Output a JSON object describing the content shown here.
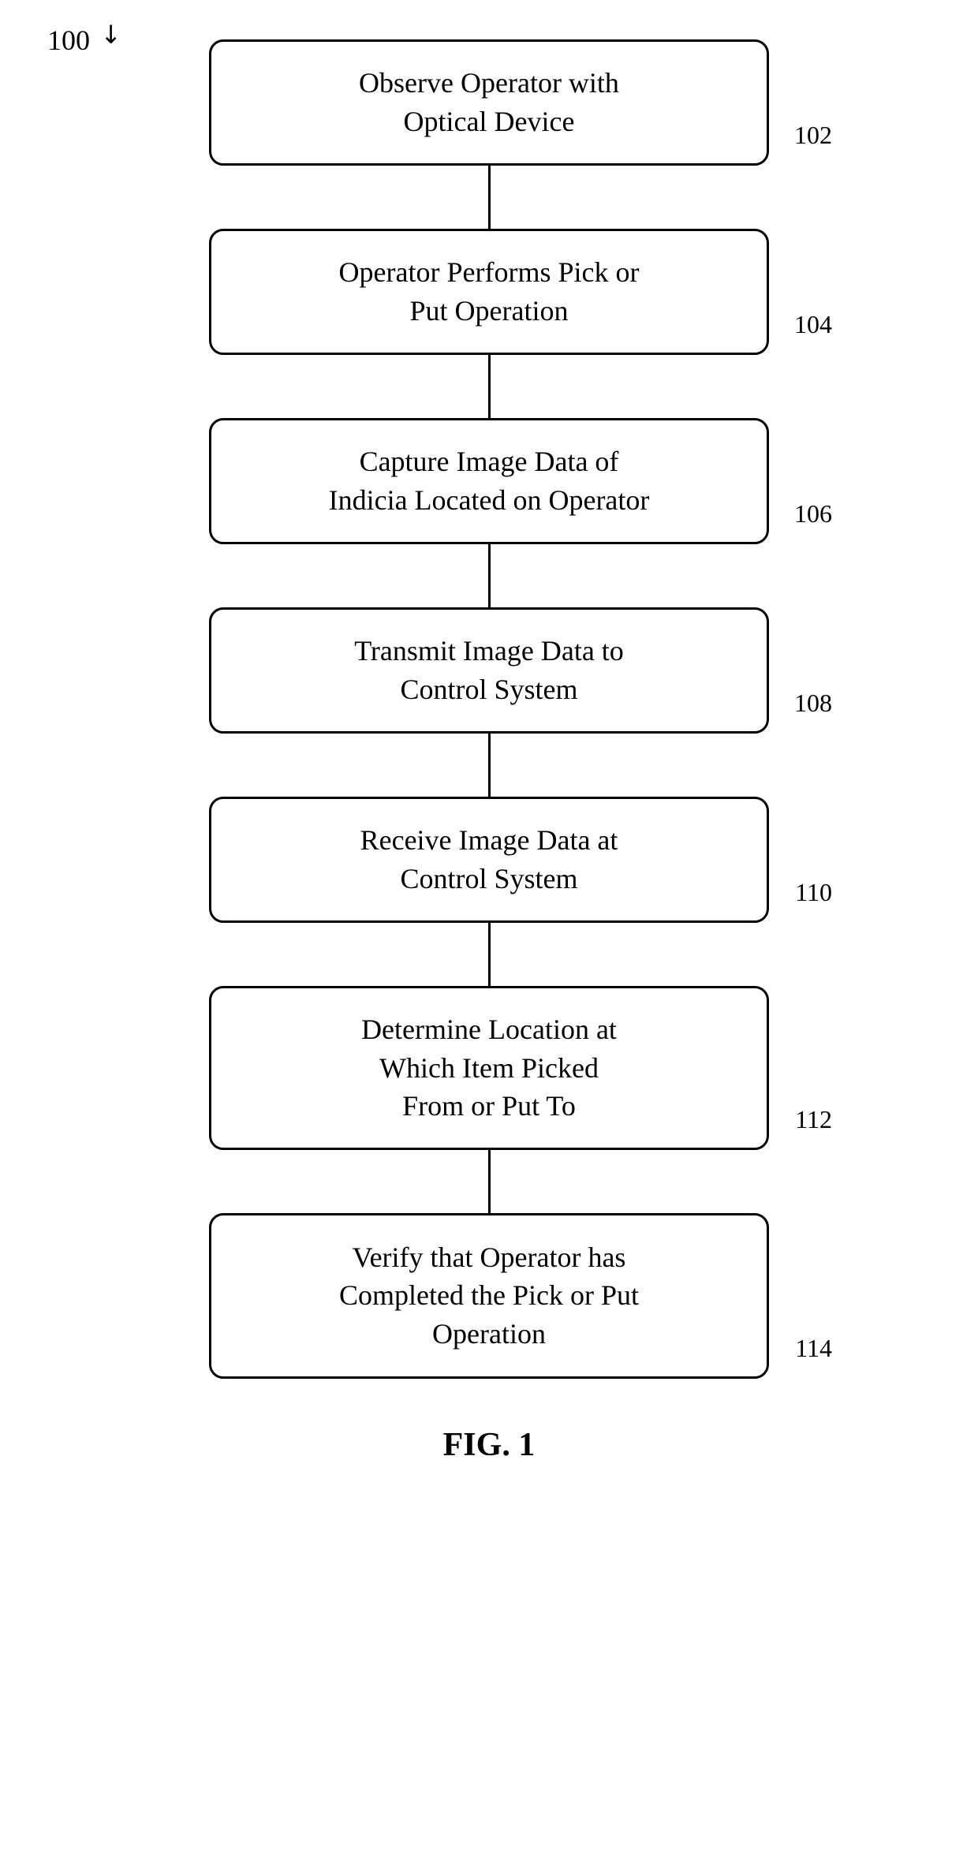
{
  "diagram": {
    "figure_label": "FIG. 1",
    "diagram_number": "100",
    "steps": [
      {
        "id": "step-102",
        "label": "102",
        "text": "Observe Operator with\nOptical Device"
      },
      {
        "id": "step-104",
        "label": "104",
        "text": "Operator Performs Pick or\nPut Operation"
      },
      {
        "id": "step-106",
        "label": "106",
        "text": "Capture Image Data of\nIndicia Located on Operator"
      },
      {
        "id": "step-108",
        "label": "108",
        "text": "Transmit Image Data to\nControl System"
      },
      {
        "id": "step-110",
        "label": "110",
        "text": "Receive Image Data at\nControl System"
      },
      {
        "id": "step-112",
        "label": "112",
        "text": "Determine Location at\nWhich Item Picked\nFrom or Put To"
      },
      {
        "id": "step-114",
        "label": "114",
        "text": "Verify that Operator has\nCompleted the Pick or Put\nOperation"
      }
    ]
  }
}
